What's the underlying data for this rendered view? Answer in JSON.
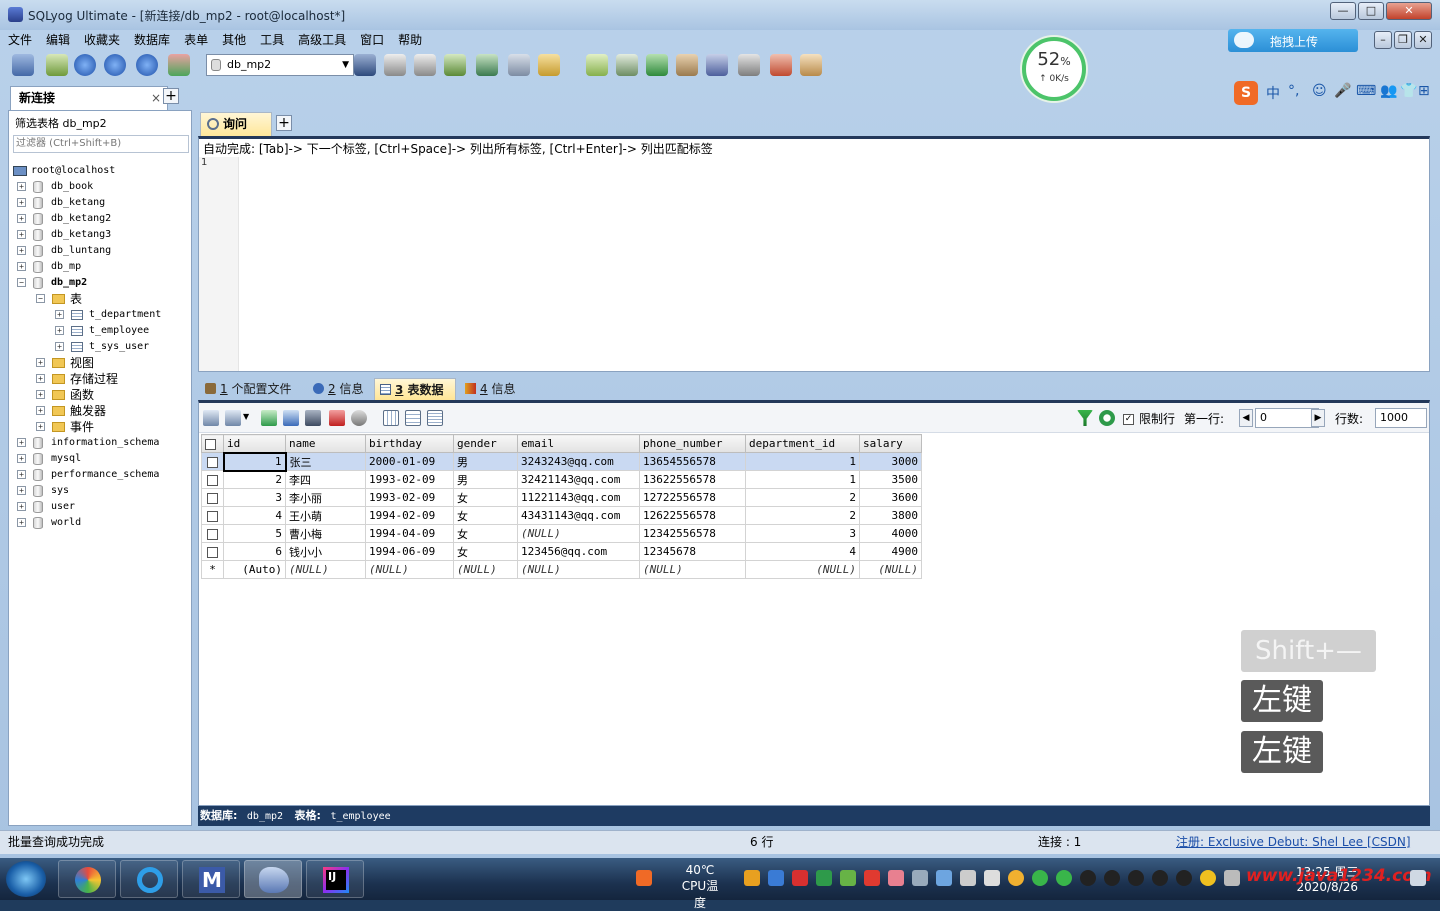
{
  "window": {
    "title": "SQLyog Ultimate - [新连接/db_mp2 - root@localhost*]",
    "controls": {
      "minimize": "—",
      "maximize": "□",
      "close": "✕"
    }
  },
  "menu": [
    "文件",
    "编辑",
    "收藏夹",
    "数据库",
    "表单",
    "其他",
    "工具",
    "高级工具",
    "窗口",
    "帮助"
  ],
  "toolbar": {
    "db_select": "db_mp2"
  },
  "gauge": {
    "percent": "52",
    "unit": "%",
    "speed": "0K/s"
  },
  "baidu": {
    "label": "拖拽上传"
  },
  "ime": {
    "items": [
      "中",
      "°,",
      "☺",
      "🎤",
      "⌨",
      "👥",
      "👕",
      "⊞"
    ]
  },
  "connection_tab": {
    "label": "新连接",
    "close": "×",
    "add": "+"
  },
  "left": {
    "filter_label": "筛选表格 db_mp2",
    "filter_placeholder": "过滤器 (Ctrl+Shift+B)",
    "tree": [
      {
        "label": "root@localhost",
        "level": 0,
        "icon": "server",
        "expander": ""
      },
      {
        "label": "db_book",
        "level": 1,
        "icon": "db",
        "expander": "+"
      },
      {
        "label": "db_ketang",
        "level": 1,
        "icon": "db",
        "expander": "+"
      },
      {
        "label": "db_ketang2",
        "level": 1,
        "icon": "db",
        "expander": "+"
      },
      {
        "label": "db_ketang3",
        "level": 1,
        "icon": "db",
        "expander": "+"
      },
      {
        "label": "db_luntang",
        "level": 1,
        "icon": "db",
        "expander": "+"
      },
      {
        "label": "db_mp",
        "level": 1,
        "icon": "db",
        "expander": "+"
      },
      {
        "label": "db_mp2",
        "level": 1,
        "icon": "db",
        "expander": "−",
        "bold": true
      },
      {
        "label": "表",
        "level": 2,
        "icon": "folder",
        "expander": "−"
      },
      {
        "label": "t_department",
        "level": 3,
        "icon": "table",
        "expander": "+"
      },
      {
        "label": "t_employee",
        "level": 3,
        "icon": "table",
        "expander": "+"
      },
      {
        "label": "t_sys_user",
        "level": 3,
        "icon": "table",
        "expander": "+"
      },
      {
        "label": "视图",
        "level": 2,
        "icon": "folder",
        "expander": "+"
      },
      {
        "label": "存储过程",
        "level": 2,
        "icon": "folder",
        "expander": "+"
      },
      {
        "label": "函数",
        "level": 2,
        "icon": "folder",
        "expander": "+"
      },
      {
        "label": "触发器",
        "level": 2,
        "icon": "folder",
        "expander": "+"
      },
      {
        "label": "事件",
        "level": 2,
        "icon": "folder",
        "expander": "+"
      },
      {
        "label": "information_schema",
        "level": 1,
        "icon": "db",
        "expander": "+"
      },
      {
        "label": "mysql",
        "level": 1,
        "icon": "db",
        "expander": "+"
      },
      {
        "label": "performance_schema",
        "level": 1,
        "icon": "db",
        "expander": "+"
      },
      {
        "label": "sys",
        "level": 1,
        "icon": "db",
        "expander": "+"
      },
      {
        "label": "user",
        "level": 1,
        "icon": "db",
        "expander": "+"
      },
      {
        "label": "world",
        "level": 1,
        "icon": "db",
        "expander": "+"
      }
    ]
  },
  "query": {
    "tab_label": "询问",
    "add": "+",
    "hint": "自动完成: [Tab]-> 下一个标签, [Ctrl+Space]-> 列出所有标签, [Ctrl+Enter]-> 列出匹配标签",
    "line_number": "1"
  },
  "result_tabs": [
    {
      "num": "1",
      "label": " 个配置文件",
      "active": false
    },
    {
      "num": "2",
      "label": " 信息",
      "active": false
    },
    {
      "num": "3",
      "label": " 表数据",
      "active": true
    },
    {
      "num": "4",
      "label": " 信息",
      "active": false
    }
  ],
  "result_toolbar": {
    "limit_label": "限制行",
    "first_row_label": "第一行:",
    "first_row_value": "0",
    "rows_label": "行数:",
    "rows_value": "1000"
  },
  "grid": {
    "columns": [
      "id",
      "name",
      "birthday",
      "gender",
      "email",
      "phone_number",
      "department_id",
      "salary"
    ],
    "rows": [
      [
        "1",
        "张三",
        "2000-01-09",
        "男",
        "3243243@qq.com",
        "13654556578",
        "1",
        "3000"
      ],
      [
        "2",
        "李四",
        "1993-02-09",
        "男",
        "32421143@qq.com",
        "13622556578",
        "1",
        "3500"
      ],
      [
        "3",
        "李小丽",
        "1993-02-09",
        "女",
        "11221143@qq.com",
        "12722556578",
        "2",
        "3600"
      ],
      [
        "4",
        "王小萌",
        "1994-02-09",
        "女",
        "43431143@qq.com",
        "12622556578",
        "2",
        "3800"
      ],
      [
        "5",
        "曹小梅",
        "1994-04-09",
        "女",
        "(NULL)",
        "12342556578",
        "3",
        "4000"
      ],
      [
        "6",
        "钱小小",
        "1994-06-09",
        "女",
        "123456@qq.com",
        "12345678",
        "4",
        "4900"
      ]
    ],
    "new_row": [
      "(Auto)",
      "(NULL)",
      "(NULL)",
      "(NULL)",
      "(NULL)",
      "(NULL)",
      "(NULL)",
      "(NULL)"
    ],
    "new_row_marker": "*"
  },
  "result_footer": {
    "db_label": "数据库:",
    "db_value": "db_mp2",
    "table_label": "表格:",
    "table_value": "t_employee"
  },
  "statusbar": {
    "left": "批量查询成功完成",
    "rows": "6 行",
    "connections": "连接 : 1",
    "register": "注册: Exclusive Debut: Shel Lee [CSDN]"
  },
  "key_overlay": {
    "shift": "Shift+—",
    "click1": "左键",
    "click2": "左键"
  },
  "taskbar": {
    "temp": "40℃",
    "temp_label": "CPU温度",
    "time": "13:25 周三",
    "date": "2020/8/26",
    "watermark": "www.java1234.com"
  }
}
